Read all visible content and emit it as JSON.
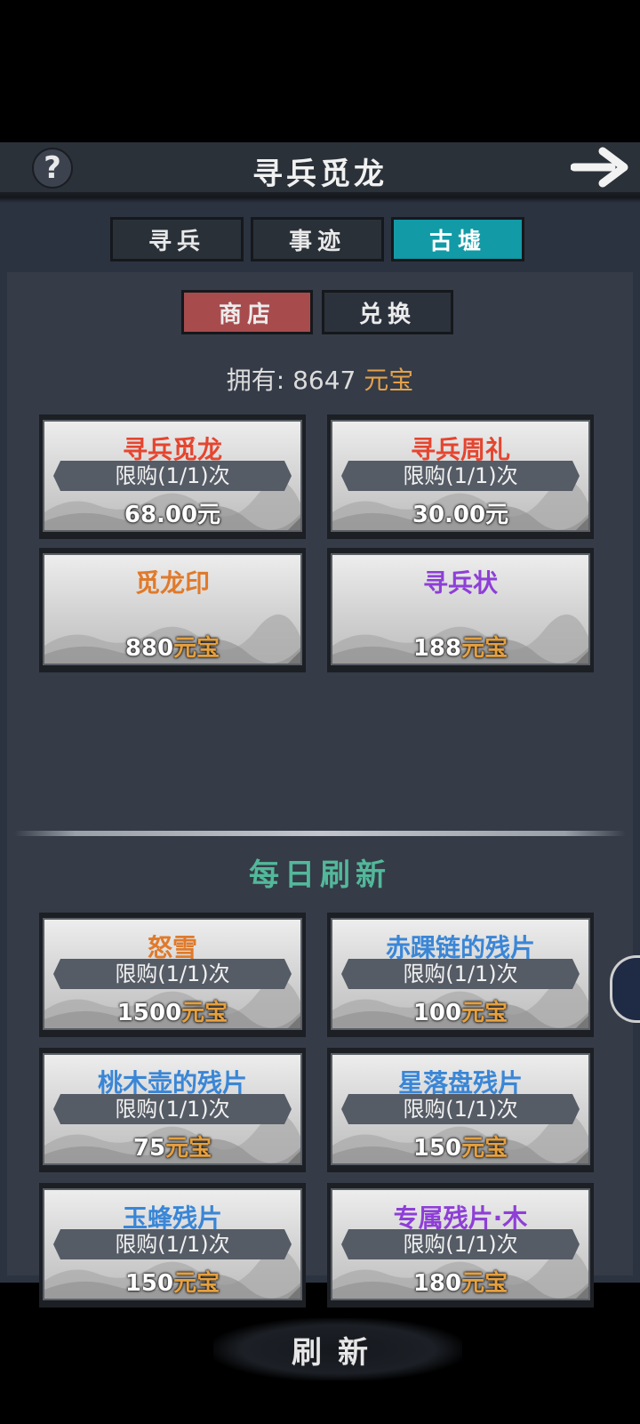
{
  "header": {
    "title": "寻兵觅龙",
    "help_icon": "?"
  },
  "tabs": [
    "寻兵",
    "事迹",
    "古墟"
  ],
  "subtabs": [
    "商店",
    "兑换"
  ],
  "owned": {
    "label": "拥有:",
    "amount": "8647",
    "currency": "元宝"
  },
  "shop": [
    {
      "name": "寻兵觅龙",
      "limit": "限购(1/1)次",
      "price": "68.00元",
      "cur": "",
      "color": "#e5452f"
    },
    {
      "name": "寻兵周礼",
      "limit": "限购(1/1)次",
      "price": "30.00元",
      "cur": "",
      "color": "#e5452f"
    },
    {
      "name": "觅龙印",
      "limit": "",
      "price": "880",
      "cur": "元宝",
      "color": "#e07a2b"
    },
    {
      "name": "寻兵状",
      "limit": "",
      "price": "188",
      "cur": "元宝",
      "color": "#8e3fd6"
    }
  ],
  "daily_title": "每日刷新",
  "daily": [
    {
      "name": "怒雪",
      "limit": "限购(1/1)次",
      "price": "1500",
      "cur": "元宝",
      "color": "#e07a2b"
    },
    {
      "name": "赤踝链的残片",
      "limit": "限购(1/1)次",
      "price": "100",
      "cur": "元宝",
      "color": "#3a86d6"
    },
    {
      "name": "桃木壶的残片",
      "limit": "限购(1/1)次",
      "price": "75",
      "cur": "元宝",
      "color": "#3a86d6"
    },
    {
      "name": "星落盘残片",
      "limit": "限购(1/1)次",
      "price": "150",
      "cur": "元宝",
      "color": "#3a86d6"
    },
    {
      "name": "玉蜂残片",
      "limit": "限购(1/1)次",
      "price": "150",
      "cur": "元宝",
      "color": "#3a86d6"
    },
    {
      "name": "专属残片·木",
      "limit": "限购(1/1)次",
      "price": "180",
      "cur": "元宝",
      "color": "#8e3fd6"
    }
  ],
  "refresh_label": "刷新"
}
